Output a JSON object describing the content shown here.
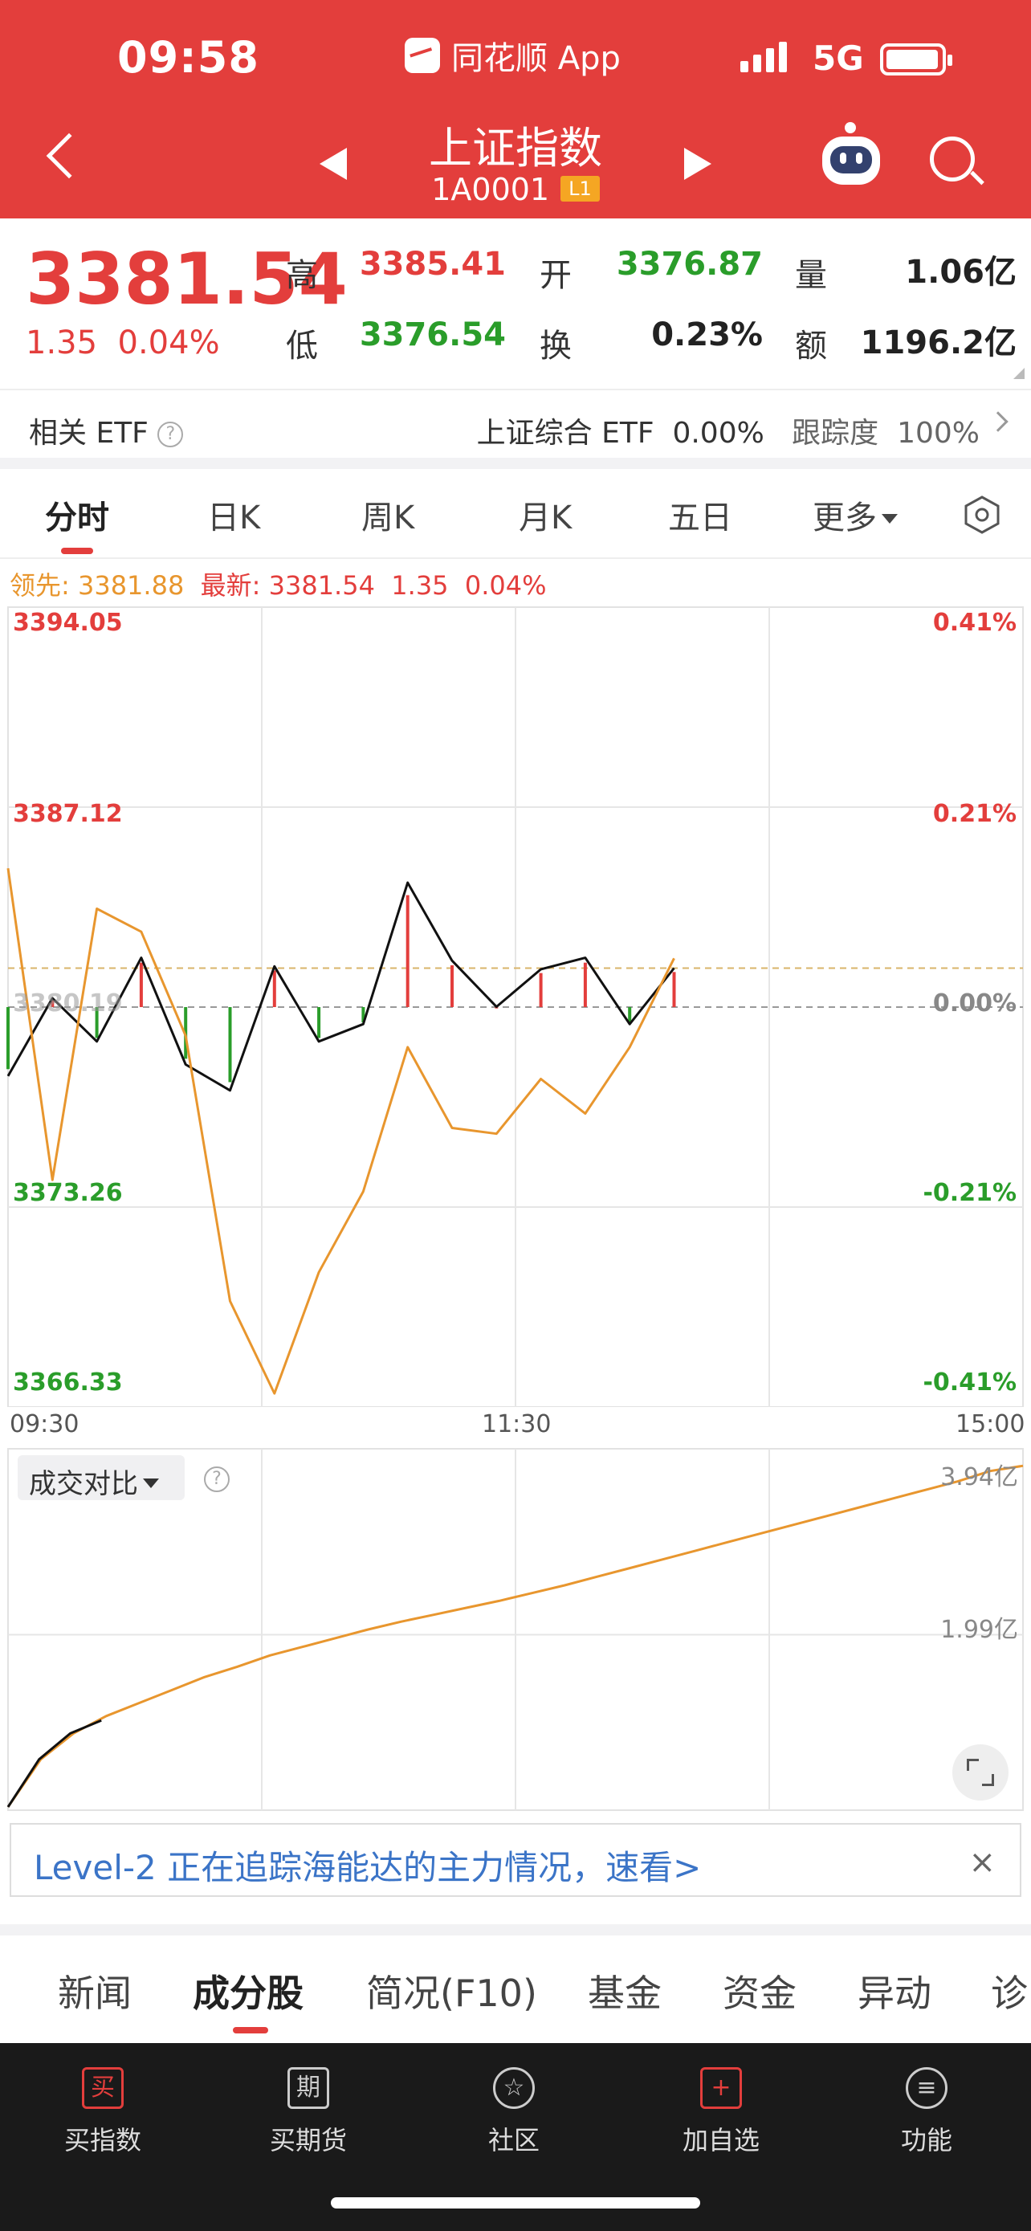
{
  "status": {
    "time": "09:58",
    "app": "同花顺 App",
    "network": "5G"
  },
  "header": {
    "title": "上证指数",
    "code": "1A0001",
    "level_badge": "L1"
  },
  "quote": {
    "price": "3381.54",
    "change": "1.35",
    "change_pct": "0.04%",
    "fields": [
      {
        "label": "高",
        "value": "3385.41",
        "color": "#e33e3c"
      },
      {
        "label": "开",
        "value": "3376.87",
        "color": "#2a9d2a"
      },
      {
        "label": "量",
        "value": "1.06亿",
        "color": "#222222"
      },
      {
        "label": "低",
        "value": "3376.54",
        "color": "#2a9d2a"
      },
      {
        "label": "换",
        "value": "0.23%",
        "color": "#222222"
      },
      {
        "label": "额",
        "value": "1196.2亿",
        "color": "#222222"
      }
    ]
  },
  "etf": {
    "left_label": "相关 ETF",
    "help": "?",
    "name": "上证综合 ETF",
    "pct": "0.00%",
    "tracking_label": "跟踪度",
    "tracking_value": "100%"
  },
  "tabs": [
    "分时",
    "日K",
    "周K",
    "月K",
    "五日",
    "更多"
  ],
  "info": {
    "lead_label": "领先: ",
    "lead_value": "3381.88",
    "latest_label": "最新: ",
    "latest_value": "3381.54",
    "change": "1.35",
    "change_pct": "0.04%"
  },
  "chart_data": [
    {
      "type": "line",
      "y_left_ticks": [
        "3394.05",
        "3387.12",
        "3380.19",
        "3373.26",
        "3366.33"
      ],
      "y_right_ticks": [
        "0.41%",
        "0.21%",
        "0.00%",
        "-0.21%",
        "-0.41%"
      ],
      "x_ticks": [
        "09:30",
        "11:30",
        "15:00"
      ],
      "ylim": [
        3366.33,
        3394.05
      ],
      "series": [
        {
          "values": [
            3377.8,
            3380.5,
            3379.0,
            3381.9,
            3378.2,
            3377.3,
            3381.6,
            3379.0,
            3379.6,
            3384.5,
            3381.8,
            3380.2,
            3381.5,
            3381.9,
            3379.6,
            3381.54
          ]
        },
        {
          "values": [
            3385.0,
            3374.2,
            3383.6,
            3382.8,
            3379.2,
            3370.0,
            3366.8,
            3371.0,
            3373.8,
            3378.8,
            3376.0,
            3375.8,
            3377.7,
            3376.5,
            3378.8,
            3381.88
          ]
        }
      ],
      "colors": [
        "#111111",
        "#e8962e"
      ],
      "reference_value": 3380.19
    },
    {
      "type": "line",
      "y_ticks": [
        "3.94亿",
        "1.99亿"
      ],
      "series": [
        {
          "values": [
            0.0,
            0.55,
            0.85,
            1.05,
            1.2,
            1.35,
            1.5,
            1.62,
            1.75,
            1.85,
            1.95,
            2.05,
            2.14,
            2.22,
            2.3,
            2.38,
            2.47,
            2.56,
            2.66,
            2.76,
            2.86,
            2.96,
            3.06,
            3.16,
            3.26,
            3.36,
            3.46,
            3.56,
            3.66,
            3.76,
            3.88,
            3.94
          ]
        },
        {
          "values": [
            0.0,
            0.55,
            0.85,
            1.0
          ]
        }
      ],
      "colors": [
        "#e8962e",
        "#111111"
      ]
    }
  ],
  "volume": {
    "selector_label": "成交对比"
  },
  "banner": {
    "text": "Level-2 正在追踪海能达的主力情况，速看>",
    "close": "×"
  },
  "sub_tabs": [
    "新闻",
    "成分股",
    "简况(F10)",
    "基金",
    "资金",
    "异动",
    "诊"
  ],
  "nav": [
    {
      "icon": "买",
      "label": "买指数"
    },
    {
      "icon": "期",
      "label": "买期货"
    },
    {
      "icon": "☆",
      "label": "社区"
    },
    {
      "icon": "+",
      "label": "加自选"
    },
    {
      "icon": "≡",
      "label": "功能"
    }
  ]
}
